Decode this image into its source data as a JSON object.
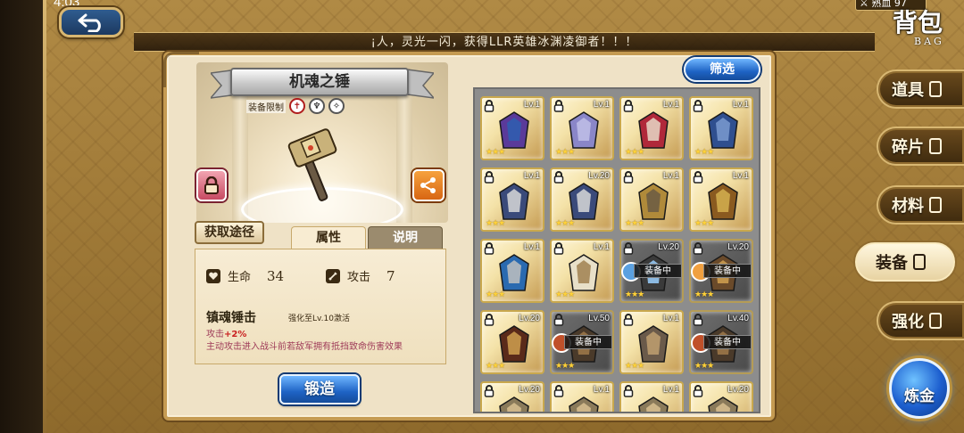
{
  "status": {
    "time": "4:03"
  },
  "header": {
    "banner_text": "¡人，灵光一闪，获得LLR英雄冰渊凌御者！！！",
    "bag_title": "背包",
    "bag_subtitle": "BAG",
    "top_badge": "⚔ 熟血 97"
  },
  "item_detail": {
    "name": "机魂之锤",
    "equip_limit_label": "装备限制",
    "acquire_label": "获取途径",
    "tabs": {
      "attr": "属性",
      "desc": "说明"
    },
    "stats": [
      {
        "label": "生命",
        "value": "34",
        "icon": "heart-icon"
      },
      {
        "label": "攻击",
        "value": "7",
        "icon": "sword-icon"
      }
    ],
    "skill": {
      "name": "镇魂锤击",
      "unlock": "强化至Lv.10激活",
      "bonus_prefix": "攻击",
      "bonus_value": "+2%",
      "desc": "主动攻击进入战斗前若敌军拥有抵挡致命伤害效果"
    },
    "forge_label": "锻造"
  },
  "filter_label": "筛选",
  "inventory": [
    {
      "lv": "Lv.1",
      "stars": "★★★",
      "kind": "robe-purple",
      "equipped": false
    },
    {
      "lv": "Lv.1",
      "stars": "★★★",
      "kind": "robe-lilac",
      "equipped": false
    },
    {
      "lv": "Lv.1",
      "stars": "★★★",
      "kind": "robe-red",
      "equipped": false
    },
    {
      "lv": "Lv.1",
      "stars": "★★★",
      "kind": "armor-blue",
      "equipped": false
    },
    {
      "lv": "Lv.1",
      "stars": "★★★",
      "kind": "armor-wing",
      "equipped": false
    },
    {
      "lv": "Lv.20",
      "stars": "★★★",
      "kind": "armor-wing",
      "equipped": false
    },
    {
      "lv": "Lv.1",
      "stars": "★★★",
      "kind": "hammer",
      "equipped": false
    },
    {
      "lv": "Lv.1",
      "stars": "★★★",
      "kind": "axe",
      "equipped": false
    },
    {
      "lv": "Lv.1",
      "stars": "★★★",
      "kind": "spear",
      "equipped": false
    },
    {
      "lv": "Lv.1",
      "stars": "★★★",
      "kind": "bow",
      "equipped": false
    },
    {
      "lv": "Lv.20",
      "stars": "★★★",
      "kind": "sword",
      "equipped": true,
      "tag": "装备中",
      "avatar": "#5aa0e0"
    },
    {
      "lv": "Lv.20",
      "stars": "★★★",
      "kind": "key",
      "equipped": true,
      "tag": "装备中",
      "avatar": "#f0a040"
    },
    {
      "lv": "Lv.20",
      "stars": "★★★",
      "kind": "ring",
      "equipped": false
    },
    {
      "lv": "Lv.50",
      "stars": "★★★",
      "kind": "boots",
      "equipped": true,
      "tag": "装备中",
      "avatar": "#c0502a"
    },
    {
      "lv": "Lv.1",
      "stars": "★★★",
      "kind": "gauntlet",
      "equipped": false
    },
    {
      "lv": "Lv.40",
      "stars": "★★★",
      "kind": "boots",
      "equipped": true,
      "tag": "装备中",
      "avatar": "#c0502a"
    },
    {
      "lv": "Lv.20",
      "stars": "★★★",
      "kind": "helm",
      "equipped": false
    },
    {
      "lv": "Lv.1",
      "stars": "★★★",
      "kind": "helm",
      "equipped": false
    },
    {
      "lv": "Lv.1",
      "stars": "★★★",
      "kind": "helm",
      "equipped": false
    },
    {
      "lv": "Lv.20",
      "stars": "★★★",
      "kind": "helm",
      "equipped": false
    }
  ],
  "side_nav": [
    {
      "label": "道具",
      "active": false
    },
    {
      "label": "碎片",
      "active": false
    },
    {
      "label": "材料",
      "active": false
    },
    {
      "label": "装备",
      "active": true
    },
    {
      "label": "强化",
      "active": false
    }
  ],
  "alchemy_label": "炼金"
}
